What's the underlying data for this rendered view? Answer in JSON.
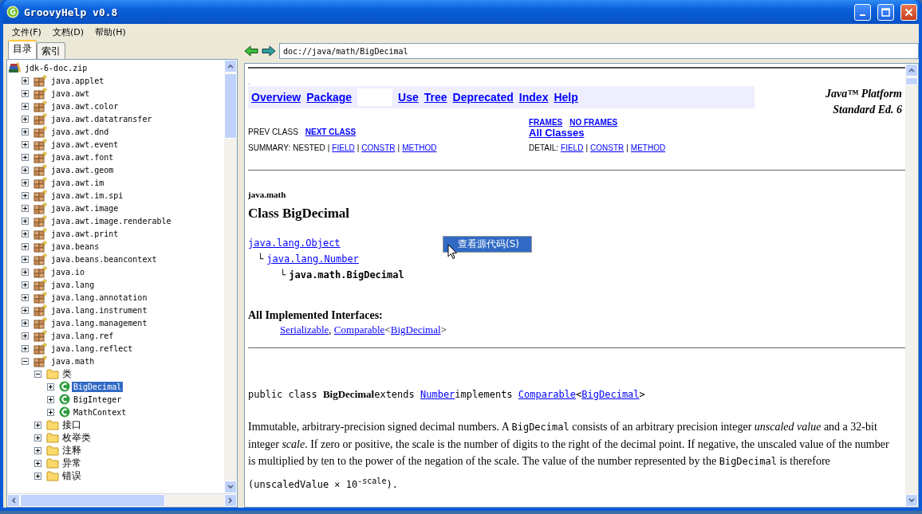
{
  "window": {
    "title": "GroovyHelp v0.8"
  },
  "menu": [
    {
      "label": "文件(F)"
    },
    {
      "label": "文档(D)"
    },
    {
      "label": "帮助(H)"
    }
  ],
  "tabs": [
    {
      "label": "目录",
      "selected": true
    },
    {
      "label": "索引",
      "selected": false
    }
  ],
  "tree": [
    {
      "label": "jdk-6-doc.zip",
      "kind": "zip",
      "selected": false,
      "children": [
        {
          "label": "java.applet",
          "kind": "package",
          "expanded": false,
          "selected": false
        },
        {
          "label": "java.awt",
          "kind": "package",
          "expanded": false,
          "selected": false
        },
        {
          "label": "java.awt.color",
          "kind": "package",
          "expanded": false,
          "selected": false
        },
        {
          "label": "java.awt.datatransfer",
          "kind": "package",
          "expanded": false,
          "selected": false
        },
        {
          "label": "java.awt.dnd",
          "kind": "package",
          "expanded": false,
          "selected": false
        },
        {
          "label": "java.awt.event",
          "kind": "package",
          "expanded": false,
          "selected": false
        },
        {
          "label": "java.awt.font",
          "kind": "package",
          "expanded": false,
          "selected": false
        },
        {
          "label": "java.awt.geom",
          "kind": "package",
          "expanded": false,
          "selected": false
        },
        {
          "label": "java.awt.im",
          "kind": "package",
          "expanded": false,
          "selected": false
        },
        {
          "label": "java.awt.im.spi",
          "kind": "package",
          "expanded": false,
          "selected": false
        },
        {
          "label": "java.awt.image",
          "kind": "package",
          "expanded": false,
          "selected": false
        },
        {
          "label": "java.awt.image.renderable",
          "kind": "package",
          "expanded": false,
          "selected": false
        },
        {
          "label": "java.awt.print",
          "kind": "package",
          "expanded": false,
          "selected": false
        },
        {
          "label": "java.beans",
          "kind": "package",
          "expanded": false,
          "selected": false
        },
        {
          "label": "java.beans.beancontext",
          "kind": "package",
          "expanded": false,
          "selected": false
        },
        {
          "label": "java.io",
          "kind": "package",
          "expanded": false,
          "selected": false
        },
        {
          "label": "java.lang",
          "kind": "package",
          "expanded": false,
          "selected": false
        },
        {
          "label": "java.lang.annotation",
          "kind": "package",
          "expanded": false,
          "selected": false
        },
        {
          "label": "java.lang.instrument",
          "kind": "package",
          "expanded": false,
          "selected": false
        },
        {
          "label": "java.lang.management",
          "kind": "package",
          "expanded": false,
          "selected": false
        },
        {
          "label": "java.lang.ref",
          "kind": "package",
          "expanded": false,
          "selected": false
        },
        {
          "label": "java.lang.reflect",
          "kind": "package",
          "expanded": false,
          "selected": false
        },
        {
          "label": "java.math",
          "kind": "package",
          "expanded": true,
          "selected": false,
          "children": [
            {
              "label": "类",
              "kind": "folder",
              "expanded": true,
              "selected": false,
              "children": [
                {
                  "label": "BigDecimal",
                  "kind": "class",
                  "expanded": false,
                  "selected": true
                },
                {
                  "label": "BigInteger",
                  "kind": "class",
                  "expanded": false,
                  "selected": false
                },
                {
                  "label": "MathContext",
                  "kind": "class",
                  "expanded": false,
                  "selected": false
                }
              ]
            },
            {
              "label": "接口",
              "kind": "folder",
              "expanded": false,
              "selected": false
            },
            {
              "label": "枚举类",
              "kind": "folder",
              "expanded": false,
              "selected": false
            },
            {
              "label": "注释",
              "kind": "folder",
              "expanded": false,
              "selected": false
            },
            {
              "label": "异常",
              "kind": "folder",
              "expanded": false,
              "selected": false
            },
            {
              "label": "错误",
              "kind": "folder",
              "expanded": false,
              "selected": false
            }
          ]
        }
      ]
    }
  ],
  "address": {
    "value": "doc://java/math/BigDecimal"
  },
  "doc": {
    "top_mark": ".",
    "navbar": [
      {
        "kind": "link",
        "label": "Overview"
      },
      {
        "kind": "link",
        "label": "Package"
      },
      {
        "kind": "current"
      },
      {
        "kind": "link",
        "label": "Use"
      },
      {
        "kind": "link",
        "label": "Tree"
      },
      {
        "kind": "link",
        "label": "Deprecated"
      },
      {
        "kind": "link",
        "label": "Index"
      },
      {
        "kind": "link",
        "label": "Help"
      }
    ],
    "platform": [
      "Java™ Platform",
      "Standard Ed. 6"
    ],
    "prev_next": [
      {
        "label": "PREV CLASS",
        "link": false
      },
      {
        "label": "NEXT CLASS",
        "link": true
      }
    ],
    "frames": [
      {
        "label": "FRAMES",
        "link": true
      },
      {
        "label": "NO FRAMES",
        "link": true
      }
    ],
    "all_classes": "All Classes",
    "summary": {
      "label": "SUMMARY:",
      "separator": "|",
      "items": [
        {
          "label": "NESTED",
          "link": false
        },
        {
          "label": "FIELD",
          "link": true
        },
        {
          "label": "CONSTR",
          "link": true
        },
        {
          "label": "METHOD",
          "link": true
        }
      ]
    },
    "detail": {
      "label": "DETAIL:",
      "separator": "|",
      "items": [
        {
          "label": "FIELD",
          "link": true
        },
        {
          "label": "CONSTR",
          "link": true
        },
        {
          "label": "METHOD",
          "link": true
        }
      ]
    },
    "package": "java.math",
    "class_title": "Class BigDecimal",
    "hierarchy": [
      {
        "label": "java.lang.Object",
        "link": true
      },
      {
        "label": "java.lang.Number",
        "link": true,
        "branch": "└"
      },
      {
        "label": "java.math.BigDecimal",
        "link": false,
        "branch": "└"
      }
    ],
    "interfaces_heading": "All Implemented Interfaces:",
    "interfaces": [
      {
        "kind": "link",
        "text": "Serializable"
      },
      {
        "kind": "text",
        "text": ", "
      },
      {
        "kind": "link",
        "text": "Comparable"
      },
      {
        "kind": "text",
        "text": "<"
      },
      {
        "kind": "link",
        "text": "BigDecimal"
      },
      {
        "kind": "text",
        "text": ">"
      }
    ],
    "declaration": [
      {
        "kind": "code",
        "text": "public class "
      },
      {
        "kind": "bold",
        "text": "BigDecimal"
      },
      {
        "kind": "code",
        "text": "extends "
      },
      {
        "kind": "codelink",
        "text": "Number"
      },
      {
        "kind": "code",
        "text": "implements "
      },
      {
        "kind": "codelink",
        "text": "Comparable"
      },
      {
        "kind": "code",
        "text": "<"
      },
      {
        "kind": "codelink",
        "text": "BigDecimal"
      },
      {
        "kind": "code",
        "text": ">"
      }
    ],
    "description": [
      {
        "kind": "text",
        "text": "Immutable, arbitrary-precision signed decimal numbers. A "
      },
      {
        "kind": "code",
        "text": "BigDecimal"
      },
      {
        "kind": "text",
        "text": " consists of an arbitrary precision integer "
      },
      {
        "kind": "italic",
        "text": "unscaled value"
      },
      {
        "kind": "text",
        "text": " and a 32-bit integer "
      },
      {
        "kind": "italic",
        "text": "scale"
      },
      {
        "kind": "text",
        "text": ". If zero or positive, the scale is the number of digits to the right of the decimal point. If negative, the unscaled value of the number is multiplied by ten to the power of the negation of the scale. The value of the number represented by the "
      },
      {
        "kind": "code",
        "text": "BigDecimal"
      },
      {
        "kind": "text",
        "text": " is therefore"
      }
    ],
    "formula": "(unscaledValue × 10$^{-scale}$)."
  },
  "context_menu": {
    "items": [
      {
        "label": "查看源代码(S)",
        "selected": true
      }
    ]
  }
}
